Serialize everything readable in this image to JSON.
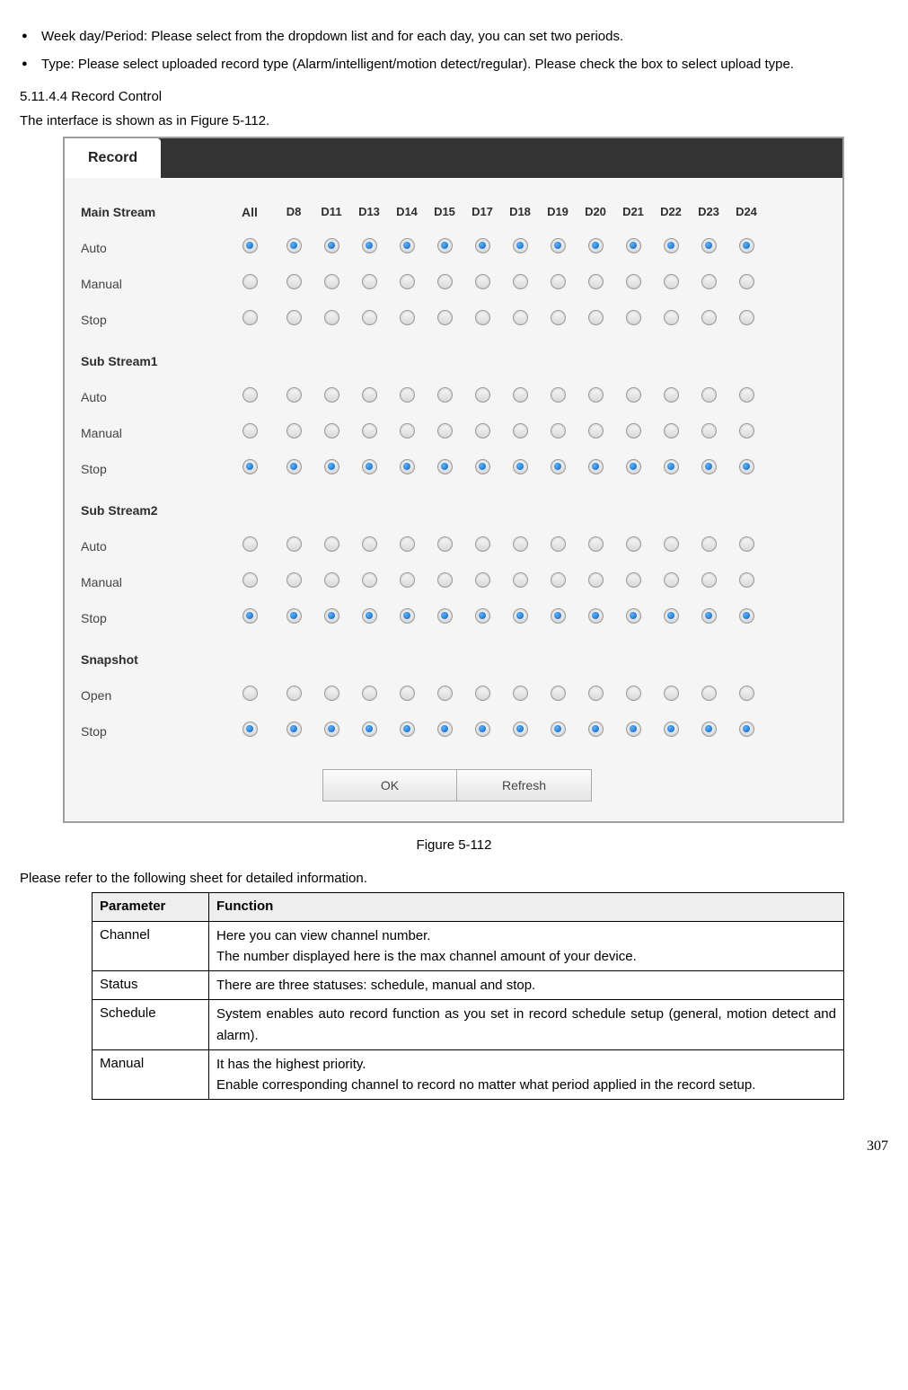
{
  "bullets": [
    "Week day/Period: Please select from the dropdown list and for each day, you can set two periods.",
    "Type: Please select uploaded record type (Alarm/intelligent/motion detect/regular). Please check the box to select upload type."
  ],
  "section_number": "5.11.4.4  Record Control",
  "intro": "The interface is shown as in Figure 5-112.",
  "tab_label": "Record",
  "header": {
    "all": "All",
    "channels": [
      "D8",
      "D11",
      "D13",
      "D14",
      "D15",
      "D17",
      "D18",
      "D19",
      "D20",
      "D21",
      "D22",
      "D23",
      "D24"
    ]
  },
  "groups": [
    {
      "title": "Main Stream",
      "rows": [
        {
          "label": "Auto",
          "all": true,
          "cells": [
            true,
            true,
            true,
            true,
            true,
            true,
            true,
            true,
            true,
            true,
            true,
            true,
            true
          ]
        },
        {
          "label": "Manual",
          "all": false,
          "cells": [
            false,
            false,
            false,
            false,
            false,
            false,
            false,
            false,
            false,
            false,
            false,
            false,
            false
          ]
        },
        {
          "label": "Stop",
          "all": false,
          "cells": [
            false,
            false,
            false,
            false,
            false,
            false,
            false,
            false,
            false,
            false,
            false,
            false,
            false
          ]
        }
      ]
    },
    {
      "title": "Sub Stream1",
      "rows": [
        {
          "label": "Auto",
          "all": false,
          "cells": [
            false,
            false,
            false,
            false,
            false,
            false,
            false,
            false,
            false,
            false,
            false,
            false,
            false
          ]
        },
        {
          "label": "Manual",
          "all": false,
          "cells": [
            false,
            false,
            false,
            false,
            false,
            false,
            false,
            false,
            false,
            false,
            false,
            false,
            false
          ]
        },
        {
          "label": "Stop",
          "all": true,
          "cells": [
            true,
            true,
            true,
            true,
            true,
            true,
            true,
            true,
            true,
            true,
            true,
            true,
            true
          ]
        }
      ]
    },
    {
      "title": "Sub Stream2",
      "rows": [
        {
          "label": "Auto",
          "all": false,
          "cells": [
            false,
            false,
            false,
            false,
            false,
            false,
            false,
            false,
            false,
            false,
            false,
            false,
            false
          ]
        },
        {
          "label": "Manual",
          "all": false,
          "cells": [
            false,
            false,
            false,
            false,
            false,
            false,
            false,
            false,
            false,
            false,
            false,
            false,
            false
          ]
        },
        {
          "label": "Stop",
          "all": true,
          "cells": [
            true,
            true,
            true,
            true,
            true,
            true,
            true,
            true,
            true,
            true,
            true,
            true,
            true
          ]
        }
      ]
    },
    {
      "title": "Snapshot",
      "rows": [
        {
          "label": "Open",
          "all": false,
          "cells": [
            false,
            false,
            false,
            false,
            false,
            false,
            false,
            false,
            false,
            false,
            false,
            false,
            false
          ]
        },
        {
          "label": "Stop",
          "all": true,
          "cells": [
            true,
            true,
            true,
            true,
            true,
            true,
            true,
            true,
            true,
            true,
            true,
            true,
            true
          ]
        }
      ]
    }
  ],
  "buttons": {
    "ok": "OK",
    "refresh": "Refresh"
  },
  "caption": "Figure 5-112",
  "table_intro": "Please refer to the following sheet for detailed information.",
  "table": {
    "head": {
      "param": "Parameter",
      "func": "Function"
    },
    "rows": [
      {
        "param": "Channel",
        "func": "Here you can view channel number.\nThe number displayed here is the max channel amount of your device."
      },
      {
        "param": "Status",
        "func": "There are three statuses: schedule, manual and stop."
      },
      {
        "param": "Schedule",
        "func": "System enables auto record function as you set in record schedule setup (general, motion detect and alarm)."
      },
      {
        "param": "Manual",
        "func": "It has the highest priority.\nEnable corresponding channel to record no matter what period applied in the record setup."
      }
    ]
  },
  "page_number": "307"
}
